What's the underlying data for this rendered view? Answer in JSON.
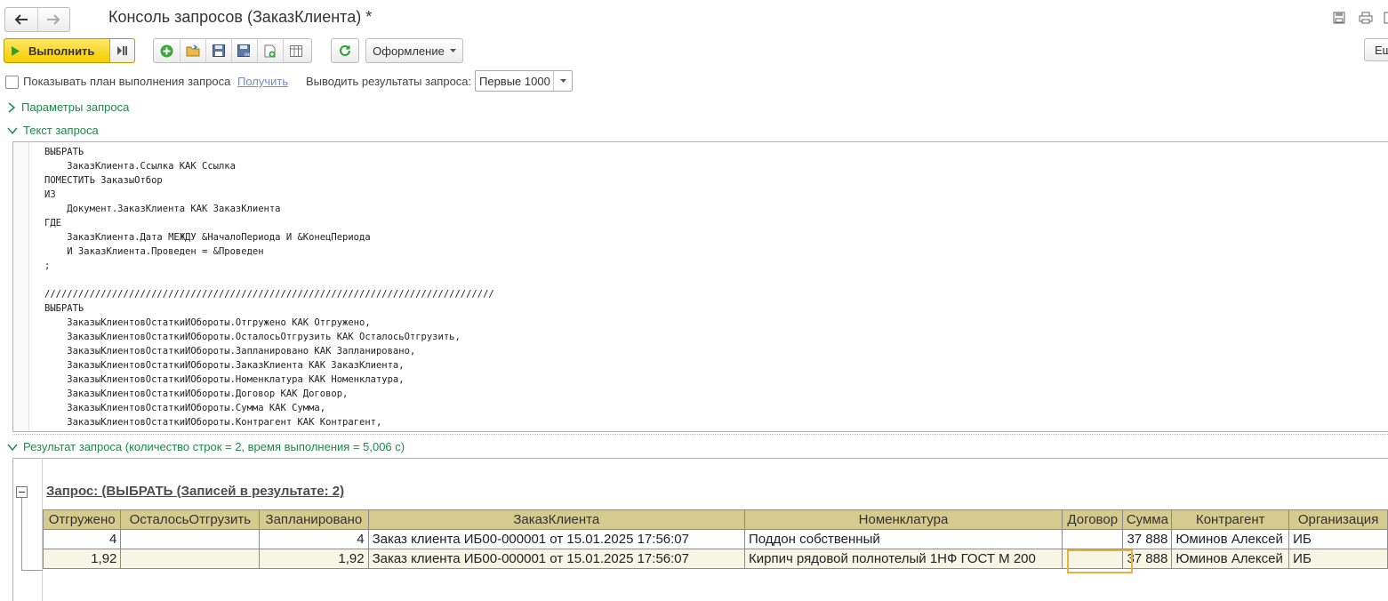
{
  "window": {
    "title": "Консоль запросов (ЗаказКлиента) *"
  },
  "toolbar": {
    "run_label": "Выполнить",
    "design_label": "Оформление",
    "right_label": "Ещё"
  },
  "options": {
    "show_plan_label": "Показывать план выполнения запроса",
    "get_link": "Получить",
    "output_label": "Выводить результаты запроса:",
    "output_value": "Первые 1000"
  },
  "sections": {
    "params": "Параметры запроса",
    "query_text": "Текст запроса",
    "result": "Результат запроса (количество строк = 2, время выполнения = 5,006 с)"
  },
  "query": {
    "lines": [
      "ВЫБРАТЬ",
      "    ЗаказКлиента.Ссылка КАК Ссылка",
      "ПОМЕСТИТЬ ЗаказыОтбор",
      "ИЗ",
      "    Документ.ЗаказКлиента КАК ЗаказКлиента",
      "ГДЕ",
      "    ЗаказКлиента.Дата МЕЖДУ &НачалоПериода И &КонецПериода",
      "    И ЗаказКлиента.Проведен = &Проведен",
      ";",
      "",
      "////////////////////////////////////////////////////////////////////////////////",
      "ВЫБРАТЬ",
      "    ЗаказыКлиентовОстаткиИОбороты.Отгружено КАК Отгружено,",
      "    ЗаказыКлиентовОстаткиИОбороты.ОсталосьОтгрузить КАК ОсталосьОтгрузить,",
      "    ЗаказыКлиентовОстаткиИОбороты.Запланировано КАК Запланировано,",
      "    ЗаказыКлиентовОстаткиИОбороты.ЗаказКлиента КАК ЗаказКлиента,",
      "    ЗаказыКлиентовОстаткиИОбороты.Номенклатура КАК Номенклатура,",
      "    ЗаказыКлиентовОстаткиИОбороты.Договор КАК Договор,",
      "    ЗаказыКлиентовОстаткиИОбороты.Сумма КАК Сумма,",
      "    ЗаказыКлиентовОстаткиИОбороты.Контрагент КАК Контрагент,"
    ]
  },
  "report": {
    "title": "Запрос: (ВЫБРАТЬ (Записей в результате: 2)",
    "columns": [
      "Отгружено",
      "ОсталосьОтгрузить",
      "Запланировано",
      "ЗаказКлиента",
      "Номенклатура",
      "Договор",
      "Сумма",
      "Контрагент",
      "Организация"
    ],
    "rows": [
      [
        "4",
        "",
        "4",
        "Заказ клиента ИБ00-000001 от 15.01.2025 17:56:07",
        "Поддон собственный",
        "",
        "37 888",
        "Юминов Алексей",
        "ИБ"
      ],
      [
        "1,92",
        "",
        "1,92",
        "Заказ клиента ИБ00-000001 от 15.01.2025 17:56:07",
        "Кирпич рядовой полнотелый 1НФ ГОСТ М 200",
        "",
        "37 888",
        "Юминов Алексей",
        "ИБ"
      ]
    ]
  },
  "colors": {
    "run_button": "#f5cc00",
    "section_text": "#1e8a4a",
    "header_fill": "#d6cb8e",
    "selection": "#e6b43c"
  }
}
